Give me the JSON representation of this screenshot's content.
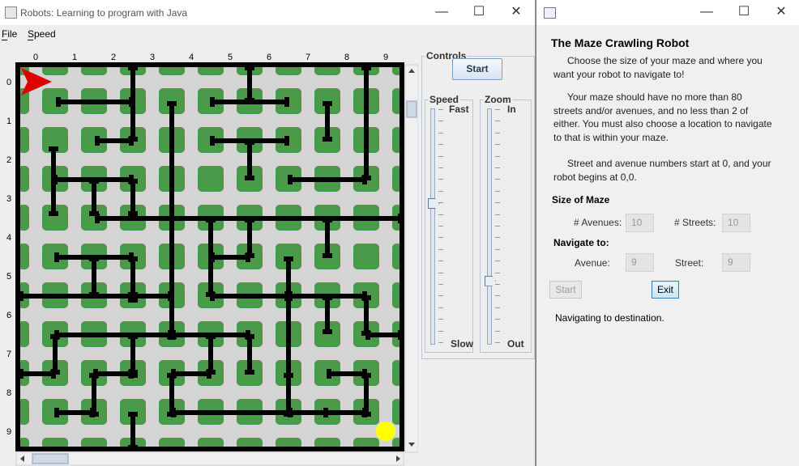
{
  "main_window": {
    "title": "Robots: Learning to program with Java",
    "menu": [
      {
        "label": "File",
        "mnemonic": "F"
      },
      {
        "label": "Speed",
        "mnemonic": "S"
      }
    ],
    "controls": {
      "group_label": "Controls",
      "start_label": "Start",
      "speed_label": "Speed",
      "speed_top": "Fast",
      "speed_bottom": "Slow",
      "speed_level": 0.6,
      "zoom_label": "Zoom",
      "zoom_top": "In",
      "zoom_bottom": "Out",
      "zoom_level": 0.27
    },
    "maze": {
      "avenue_labels": [
        "0",
        "1",
        "2",
        "3",
        "4",
        "5",
        "6",
        "7",
        "8",
        "9"
      ],
      "street_labels": [
        "0",
        "1",
        "2",
        "3",
        "4",
        "5",
        "6",
        "7",
        "8",
        "9"
      ],
      "robot": {
        "avenue": 0,
        "street": 0,
        "direction": "east",
        "color": "#e00000"
      },
      "destination": {
        "avenue": 9,
        "street": 9,
        "color": "#ffff00"
      },
      "block_color": "#4a9a4a",
      "wall_color": "#000000",
      "background_color": "#d4d4d4"
    }
  },
  "dialog": {
    "title": "",
    "heading": "The Maze Crawling Robot",
    "para1": "Choose the size of your maze and where you want your robot to navigate to!",
    "para2": "Your maze should have no more than 80 streets and/or avenues, and no less than 2 of either.  You must also choose a location to navigate to that is within your maze.",
    "para3": "Street and avenue numbers start at 0, and your robot begins at 0,0.",
    "size_heading": "Size of Maze",
    "avenues_label": "# Avenues:",
    "avenues_value": "10",
    "streets_label": "# Streets:",
    "streets_value": "10",
    "navigate_heading": "Navigate to:",
    "nav_avenue_label": "Avenue:",
    "nav_avenue_value": "9",
    "nav_street_label": "Street:",
    "nav_street_value": "9",
    "start_label": "Start",
    "exit_label": "Exit",
    "status": "Navigating to destination."
  }
}
